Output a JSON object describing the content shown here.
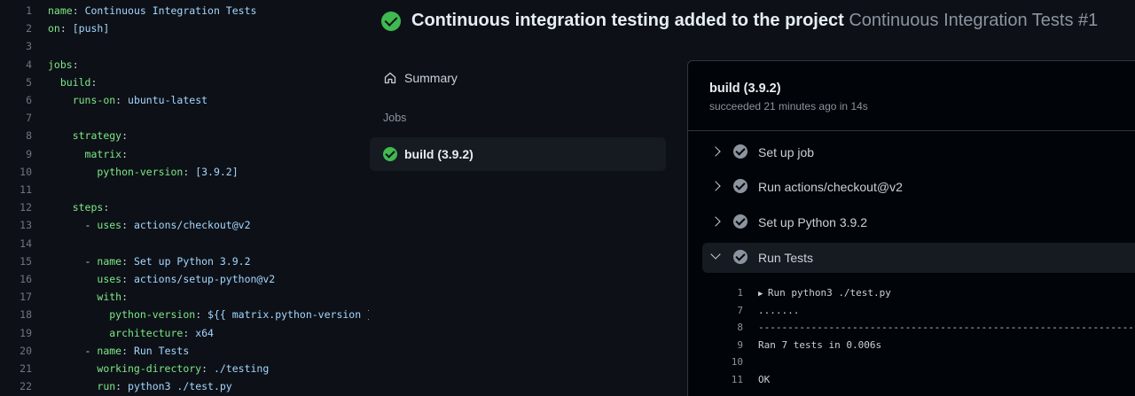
{
  "editor": {
    "lines": [
      {
        "n": "1",
        "indent": "",
        "key": "name",
        "sep": ": ",
        "val": "Continuous Integration Tests"
      },
      {
        "n": "2",
        "indent": "",
        "key": "on",
        "sep": ": ",
        "val": "[push]"
      },
      {
        "n": "3",
        "indent": "",
        "key": "",
        "sep": "",
        "val": ""
      },
      {
        "n": "4",
        "indent": "",
        "key": "jobs",
        "sep": ":",
        "val": ""
      },
      {
        "n": "5",
        "indent": "  ",
        "key": "build",
        "sep": ":",
        "val": ""
      },
      {
        "n": "6",
        "indent": "    ",
        "key": "runs-on",
        "sep": ": ",
        "val": "ubuntu-latest"
      },
      {
        "n": "7",
        "indent": "",
        "key": "",
        "sep": "",
        "val": ""
      },
      {
        "n": "8",
        "indent": "    ",
        "key": "strategy",
        "sep": ":",
        "val": ""
      },
      {
        "n": "9",
        "indent": "      ",
        "key": "matrix",
        "sep": ":",
        "val": ""
      },
      {
        "n": "10",
        "indent": "        ",
        "key": "python-version",
        "sep": ": ",
        "val": "[3.9.2]"
      },
      {
        "n": "11",
        "indent": "",
        "key": "",
        "sep": "",
        "val": ""
      },
      {
        "n": "12",
        "indent": "    ",
        "key": "steps",
        "sep": ":",
        "val": ""
      },
      {
        "n": "13",
        "indent": "      - ",
        "key": "uses",
        "sep": ": ",
        "val": "actions/checkout@v2"
      },
      {
        "n": "14",
        "indent": "",
        "key": "",
        "sep": "",
        "val": ""
      },
      {
        "n": "15",
        "indent": "      - ",
        "key": "name",
        "sep": ": ",
        "val": "Set up Python 3.9.2"
      },
      {
        "n": "16",
        "indent": "        ",
        "key": "uses",
        "sep": ": ",
        "val": "actions/setup-python@v2"
      },
      {
        "n": "17",
        "indent": "        ",
        "key": "with",
        "sep": ":",
        "val": ""
      },
      {
        "n": "18",
        "indent": "          ",
        "key": "python-version",
        "sep": ": ",
        "val": "${{ matrix.python-version }}"
      },
      {
        "n": "19",
        "indent": "          ",
        "key": "architecture",
        "sep": ": ",
        "val": "x64"
      },
      {
        "n": "20",
        "indent": "      - ",
        "key": "name",
        "sep": ": ",
        "val": "Run Tests"
      },
      {
        "n": "21",
        "indent": "        ",
        "key": "working-directory",
        "sep": ": ",
        "val": "./testing"
      },
      {
        "n": "22",
        "indent": "        ",
        "key": "run",
        "sep": ": ",
        "val": "python3 ./test.py"
      }
    ]
  },
  "header": {
    "title": "Continuous integration testing added to the project",
    "subtitle": "Continuous Integration Tests #1",
    "status_icon": "check-circle-fill-icon",
    "status_color": "#3fb950"
  },
  "nav": {
    "summary_label": "Summary",
    "summary_icon": "home-icon",
    "jobs_heading": "Jobs",
    "job_label": "build (3.9.2)"
  },
  "panel": {
    "title": "build (3.9.2)",
    "status": "succeeded 21 minutes ago in 14s",
    "steps": [
      {
        "label": "Set up job",
        "expanded": false
      },
      {
        "label": "Run actions/checkout@v2",
        "expanded": false
      },
      {
        "label": "Set up Python 3.9.2",
        "expanded": false
      },
      {
        "label": "Run Tests",
        "expanded": true
      }
    ],
    "log": [
      {
        "n": "1",
        "text": "Run python3 ./test.py",
        "collapsible": true
      },
      {
        "n": "7",
        "text": ".......",
        "collapsible": false
      },
      {
        "n": "8",
        "text": "--------------------------------------------------------------------------",
        "collapsible": false
      },
      {
        "n": "9",
        "text": "Ran 7 tests in 0.006s",
        "collapsible": false
      },
      {
        "n": "10",
        "text": "",
        "collapsible": false
      },
      {
        "n": "11",
        "text": "OK",
        "collapsible": false
      }
    ]
  }
}
